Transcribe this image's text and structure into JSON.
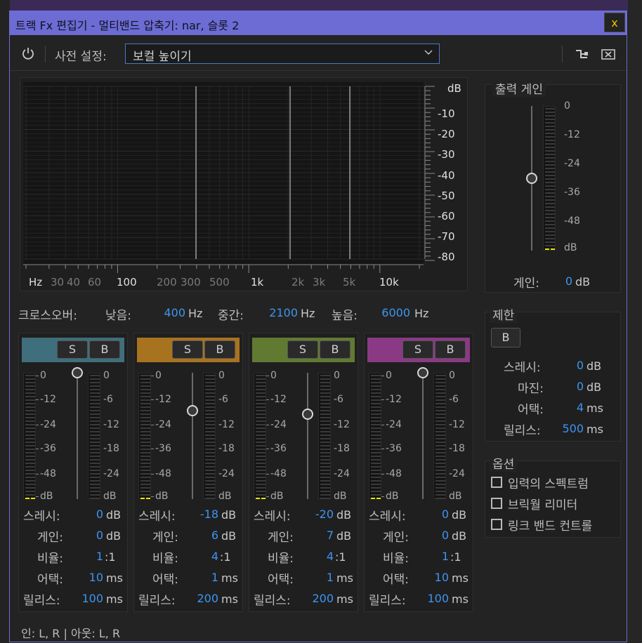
{
  "window": {
    "title": "트랙 Fx 편집기 - 멀티밴드 압축기: nar, 슬롯 2",
    "close": "x"
  },
  "toolbar": {
    "preset_label": "사전 설정:",
    "preset_value": "보컬 높이기"
  },
  "graph": {
    "db_label": "dB",
    "db_ticks": [
      "-10",
      "-20",
      "-30",
      "-40",
      "-50",
      "-60",
      "-70",
      "-80"
    ],
    "freq_labels": [
      "Hz",
      "30",
      "40",
      "60",
      "100",
      "200",
      "300",
      "500",
      "1k",
      "2k",
      "3k",
      "5k",
      "10k"
    ]
  },
  "crossover": {
    "label": "크로스오버:",
    "low_label": "낮음:",
    "low_value": "400",
    "low_unit": "Hz",
    "mid_label": "중간:",
    "mid_value": "2100",
    "mid_unit": "Hz",
    "high_label": "높음:",
    "high_value": "6000",
    "high_unit": "Hz"
  },
  "band_buttons": {
    "solo": "S",
    "bypass": "B"
  },
  "meter_scale_left": [
    "0",
    "-12",
    "-24",
    "-36",
    "-48",
    "dB"
  ],
  "meter_scale_right": [
    "0",
    "-6",
    "-12",
    "-18",
    "-24",
    "dB"
  ],
  "param_labels": {
    "threshold": "스레시:",
    "gain": "게인:",
    "ratio": "비율:",
    "attack": "어택:",
    "release": "릴리스:"
  },
  "units": {
    "db": "dB",
    "ratio": ":1",
    "ms": "ms"
  },
  "bands": [
    {
      "color": "#3f6e7d",
      "threshold": "0",
      "gain": "0",
      "ratio": "1",
      "attack": "10",
      "release": "100",
      "fader_level": 0.0
    },
    {
      "color": "#a8731f",
      "threshold": "-18",
      "gain": "6",
      "ratio": "4",
      "attack": "1",
      "release": "200",
      "fader_level": 0.3
    },
    {
      "color": "#617a32",
      "threshold": "-20",
      "gain": "7",
      "ratio": "4",
      "attack": "1",
      "release": "200",
      "fader_level": 0.33
    },
    {
      "color": "#8a3a84",
      "threshold": "0",
      "gain": "0",
      "ratio": "1",
      "attack": "10",
      "release": "100",
      "fader_level": 0.0
    }
  ],
  "output": {
    "title": "출력 게인",
    "scale": [
      "0",
      "-12",
      "-24",
      "-36",
      "-48",
      "dB"
    ],
    "gain_label": "게인:",
    "gain_value": "0",
    "gain_unit": "dB"
  },
  "limiter": {
    "title": "제한",
    "bypass": "B",
    "threshold_label": "스레시:",
    "threshold_value": "0",
    "threshold_unit": "dB",
    "margin_label": "마진:",
    "margin_value": "0",
    "margin_unit": "dB",
    "attack_label": "어택:",
    "attack_value": "4",
    "attack_unit": "ms",
    "release_label": "릴리스:",
    "release_value": "500",
    "release_unit": "ms"
  },
  "options": {
    "title": "옵션",
    "items": [
      {
        "label": "입력의 스펙트럼",
        "checked": false
      },
      {
        "label": "브릭월 리미터",
        "checked": false
      },
      {
        "label": "링크 밴드 컨트롤",
        "checked": false
      }
    ]
  },
  "footer": {
    "io": "인: L, R | 아웃: L, R"
  },
  "colors": {
    "accent": "#6c6cd4",
    "value_blue": "#3d95f0",
    "close_x": "#e8c400",
    "meter_peak": "#e8e800"
  }
}
